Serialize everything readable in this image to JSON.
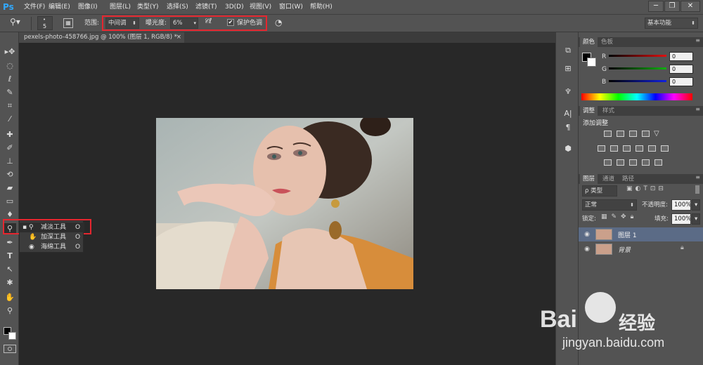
{
  "app": {
    "logo": "Ps"
  },
  "menu": [
    "文件(F)",
    "编辑(E)",
    "图像(I)",
    "图层(L)",
    "类型(Y)",
    "选择(S)",
    "滤镜(T)",
    "3D(D)",
    "视图(V)",
    "窗口(W)",
    "帮助(H)"
  ],
  "window_controls": {
    "minimize": "─",
    "restore": "❐",
    "close": "✕"
  },
  "options": {
    "brush_size": "5",
    "range_label": "范围:",
    "range_value": "中间调",
    "exposure_label": "曝光度:",
    "exposure_value": "6%",
    "protect_tones_label": "保护色调",
    "protect_tones_checked": "✔",
    "workspace": "基本功能"
  },
  "document": {
    "tab_title": "pexels-photo-458766.jpg @ 100% (图层 1, RGB/8) *",
    "close": "×"
  },
  "tool_flyout": [
    {
      "marker": "▪",
      "label": "减淡工具",
      "shortcut": "O"
    },
    {
      "marker": "",
      "label": "加深工具",
      "shortcut": "O"
    },
    {
      "marker": "",
      "label": "海绵工具",
      "shortcut": "O"
    }
  ],
  "color_panel": {
    "tabs": [
      "颜色",
      "色板"
    ],
    "channels": [
      {
        "name": "R",
        "value": "0",
        "color": "#e01010"
      },
      {
        "name": "G",
        "value": "0",
        "color": "#12b012"
      },
      {
        "name": "B",
        "value": "0",
        "color": "#1020e0"
      }
    ]
  },
  "adjust_panel": {
    "tabs": [
      "调整",
      "样式"
    ],
    "title": "添加调整"
  },
  "layers_panel": {
    "tabs": [
      "图层",
      "通道",
      "路径"
    ],
    "filter": "ρ 类型",
    "blend_mode": "正常",
    "opacity_label": "不透明度:",
    "opacity_value": "100%",
    "lock_label": "锁定:",
    "fill_label": "填充:",
    "fill_value": "100%",
    "layers": [
      {
        "name": "图层 1",
        "selected": true
      },
      {
        "name": "背景",
        "selected": false
      }
    ]
  },
  "watermark": {
    "brand": "Bai",
    "brand_cn": "经验",
    "url": "jingyan.baidu.com"
  },
  "colors": {
    "highlight": "#e5262f",
    "ps_blue": "#31a8ff",
    "selected_layer": "#5b6b86"
  }
}
